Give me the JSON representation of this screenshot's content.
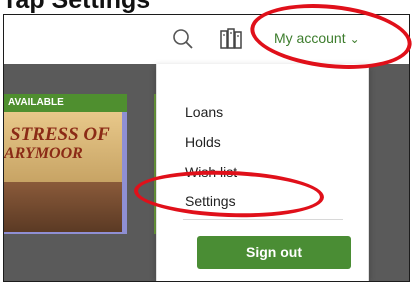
{
  "caption": "Tap Settings",
  "header": {
    "account_label": "My account",
    "chevron": "⌄"
  },
  "book": {
    "badge": "AVAILABLE",
    "title_line1": "STRESS OF",
    "title_line2": "ARYMOOR"
  },
  "menu": {
    "items": [
      "Loans",
      "Holds",
      "Wish list",
      "Settings"
    ],
    "sign_out": "Sign out"
  },
  "colors": {
    "accent_green": "#4a8d34",
    "highlight_red": "#e0101a"
  },
  "icons": [
    "search-icon",
    "library-icon",
    "chevron-down-icon"
  ]
}
